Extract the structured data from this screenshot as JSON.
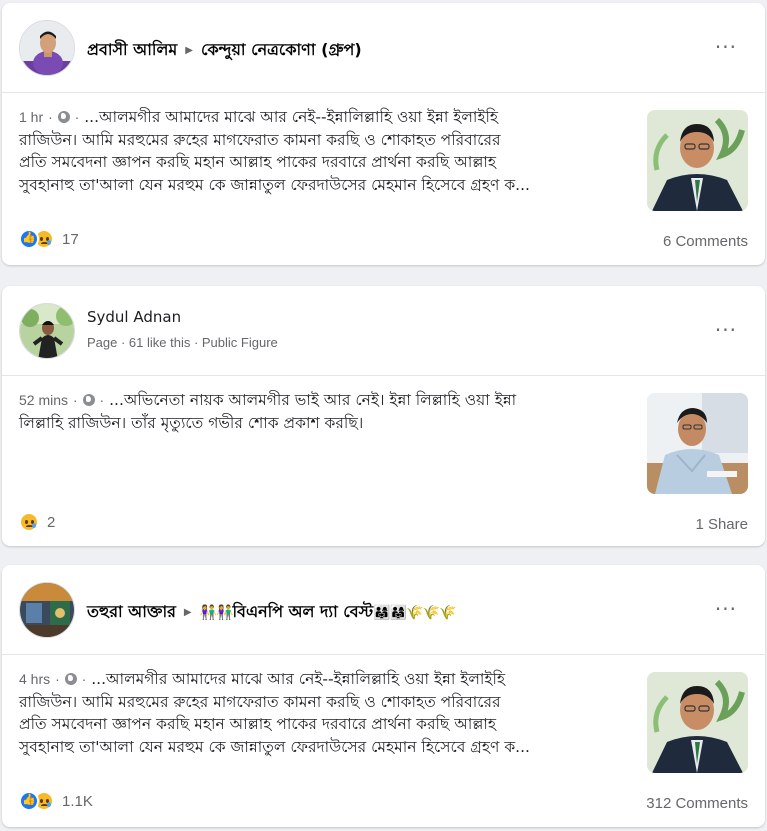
{
  "posts": [
    {
      "author": "প্রবাসী আলিম",
      "group": "কেন্দুয়া নেত্রকোণা (গ্রুপ)",
      "time": "1 hr",
      "separator": "·",
      "text_line1": "...আলমগীর আমাদের মাঝে আর নেই--ইন্নালিল্লাহি ওয়া ইন্না ইলাইহি",
      "text_line2": "রাজিউন। আমি মরহুমের রুহের মাগফেরাত কামনা করছি ও শোকাহত পরিবারের",
      "text_line3": "প্রতি সমবেদনা জ্ঞাপন করছি মহান আল্লাহ পাকের দরবারে প্রার্থনা করছি আল্লাহ",
      "text_line4": "সুবহানাহু তা'আলা যেন মরহুম কে জান্নাতুল ফেরদাউসের মেহমান হিসেবে গ্রহণ ক...",
      "reaction_count": "17",
      "footer_right": "6 Comments"
    },
    {
      "author": "Sydul Adnan",
      "page_info": "Page · 61 like this · Public Figure",
      "time": "52 mins",
      "separator": "·",
      "text_line1": "...অভিনেতা নায়ক আলমগীর ভাই আর নেই। ইন্না লিল্লাহি ওয়া ইন্না",
      "text_line2": "লিল্লাহি রাজিউন। তাঁর মৃত্যুতে গভীর শোক প্রকাশ করছি।",
      "reaction_count": "2",
      "footer_right": "1 Share"
    },
    {
      "author": "তহুরা আক্তার",
      "group_prefix": "👫👫",
      "group": "বিএনপি অল দ্যা বেস্ট",
      "group_suffix": "👨‍👩‍👧👨‍👩‍👧🌾🌾🌾",
      "time": "4 hrs",
      "separator": "·",
      "text_line1": "...আলমগীর আমাদের মাঝে আর নেই--ইন্নালিল্লাহি ওয়া ইন্না ইলাইহি",
      "text_line2": "রাজিউন। আমি মরহুমের রুহের মাগফেরাত কামনা করছি ও শোকাহত পরিবারের",
      "text_line3": "প্রতি সমবেদনা জ্ঞাপন করছি মহান আল্লাহ পাকের দরবারে প্রার্থনা করছি আল্লাহ",
      "text_line4": "সুবহানাহু তা'আলা যেন মরহুম কে জান্নাতুল ফেরদাউসের মেহমান হিসেবে গ্রহণ ক...",
      "reaction_count": "1.1K",
      "footer_right": "312 Comments"
    }
  ],
  "icons": {
    "more": "more-options-icon",
    "arrow": "caret-right-icon",
    "privacy": "globe-icon",
    "like": "like-reaction-icon",
    "sad": "sad-reaction-icon"
  },
  "more_glyph": "···",
  "arrow_glyph": "▶",
  "colors": {
    "like_blue": "#1877f2",
    "sad_yellow": "#f7b928",
    "meta_grey": "#65676b",
    "background": "#eef0f3"
  }
}
